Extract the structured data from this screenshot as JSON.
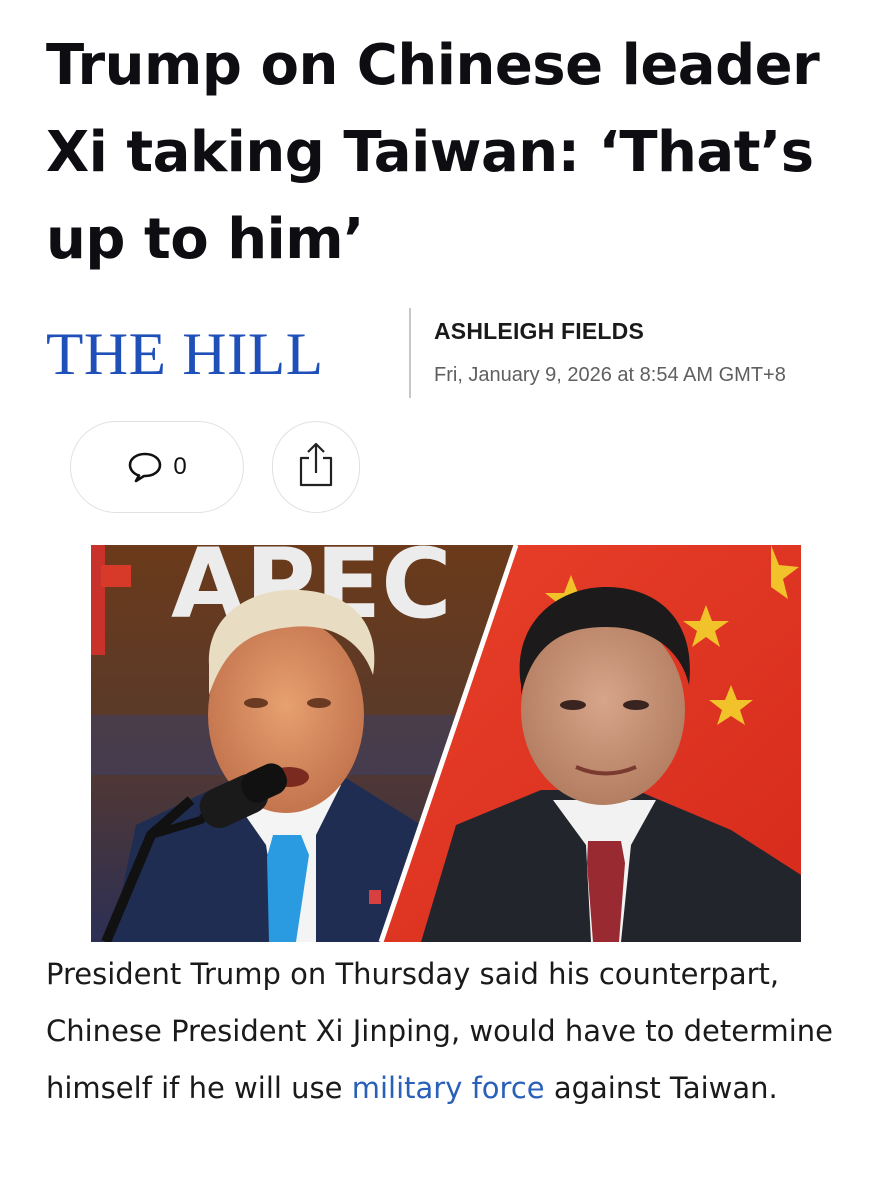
{
  "article": {
    "headline": "Trump on Chinese leader Xi taking Taiwan: ‘That’s up to him’",
    "publisher": "THE HILL",
    "author": "ASHLEIGH FIELDS",
    "dateline": "Fri, January 9, 2026 at 8:54 AM GMT+8",
    "comment_count": "0",
    "photo_sign_text": "APEC",
    "caption_before_link": "President Trump on Thursday said his counterpart, Chinese President Xi Jinping, would have to determine himself if he will use ",
    "caption_link": "military force",
    "caption_after_link": " against Taiwan."
  },
  "icons": {
    "comment": "speech-bubble-icon",
    "share": "share-arrow-icon"
  },
  "colors": {
    "brand_blue": "#1f4fb8",
    "link_blue": "#2a60b8",
    "divider_gray": "#c8c8c8",
    "date_gray": "#5f5f5f"
  }
}
